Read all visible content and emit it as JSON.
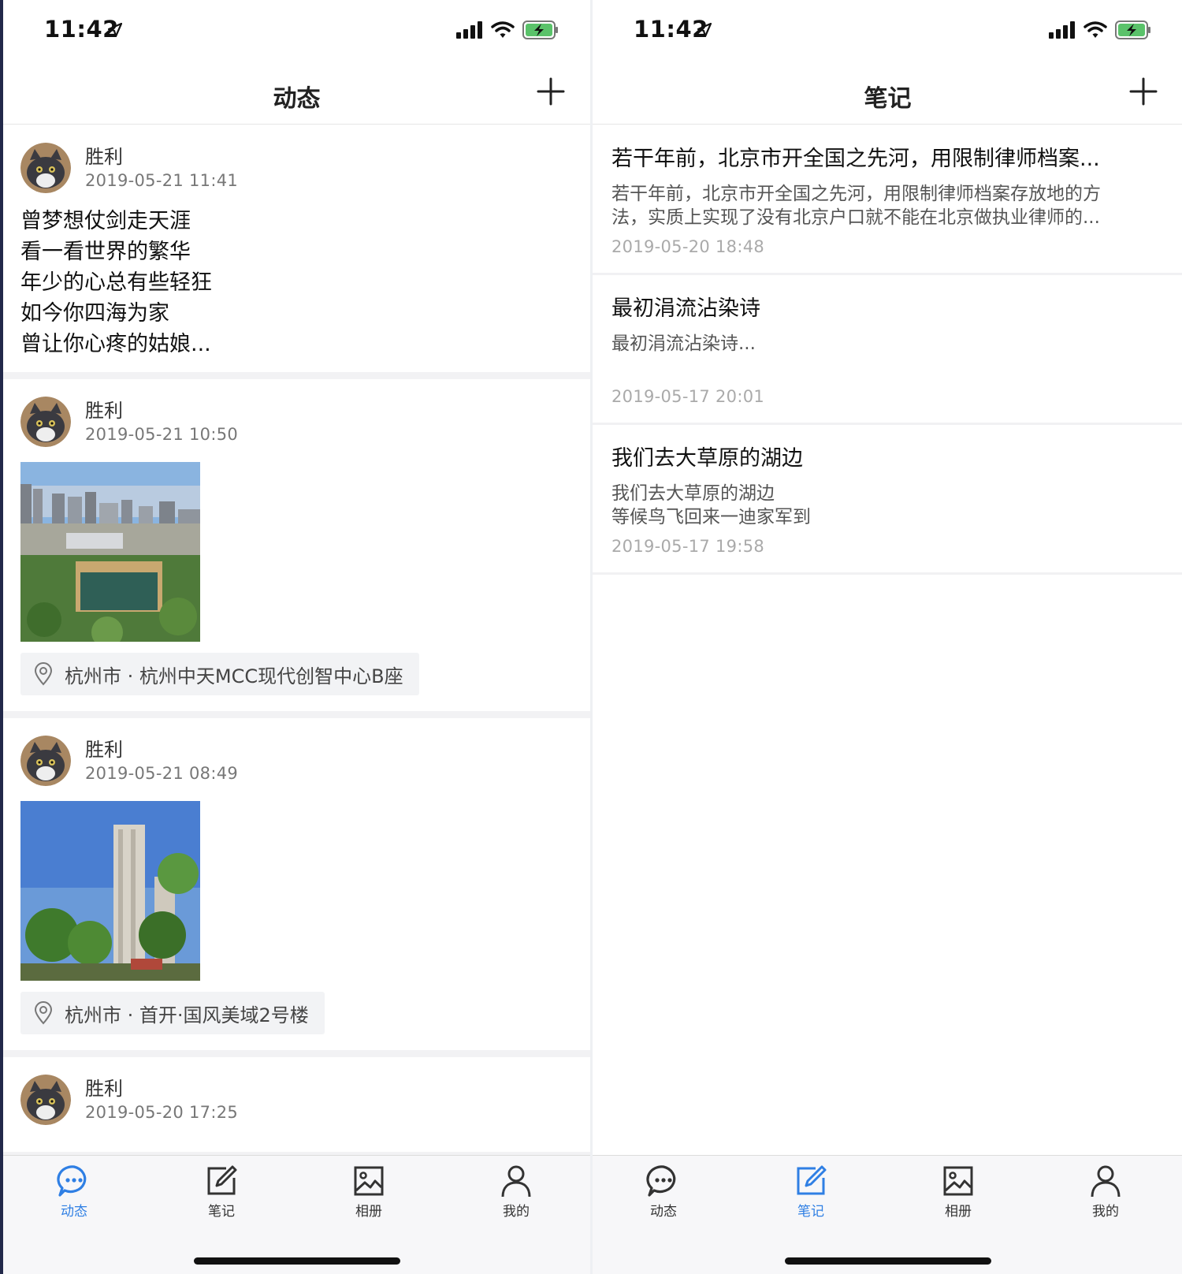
{
  "colors": {
    "accent": "#2f7fe4",
    "tab_inactive": "#333333",
    "battery_green": "#5ac26a"
  },
  "left": {
    "status": {
      "time": "11:42"
    },
    "nav": {
      "title": "动态",
      "add_icon": "plus-icon"
    },
    "posts": [
      {
        "author": "胜利",
        "time": "2019-05-21 11:41",
        "lines": [
          "曾梦想仗剑走天涯",
          "看一看世界的繁华",
          "年少的心总有些轻狂",
          "如今你四海为家",
          "曾让你心疼的姑娘..."
        ]
      },
      {
        "author": "胜利",
        "time": "2019-05-21 10:50",
        "photo": "city-aerial-photo",
        "location": "杭州市 · 杭州中天MCC现代创智中心B座"
      },
      {
        "author": "胜利",
        "time": "2019-05-21 08:49",
        "photo": "tower-photo",
        "location": "杭州市 · 首开·国风美域2号楼"
      },
      {
        "author": "胜利",
        "time": "2019-05-20 17:25"
      }
    ],
    "tabs": [
      {
        "label": "动态",
        "icon": "chat-bubble-icon",
        "active": true
      },
      {
        "label": "笔记",
        "icon": "edit-icon",
        "active": false
      },
      {
        "label": "相册",
        "icon": "image-icon",
        "active": false
      },
      {
        "label": "我的",
        "icon": "user-icon",
        "active": false
      }
    ]
  },
  "right": {
    "status": {
      "time": "11:42"
    },
    "nav": {
      "title": "笔记",
      "add_icon": "plus-icon"
    },
    "notes": [
      {
        "title": "若干年前，北京市开全国之先河，用限制律师档案...",
        "excerpt": [
          "若干年前，北京市开全国之先河，用限制律师档案存放地的方",
          "法，实质上实现了没有北京户口就不能在北京做执业律师的..."
        ],
        "time": "2019-05-20 18:48"
      },
      {
        "title": "最初涓流沾染诗",
        "excerpt": [
          "最初涓流沾染诗..."
        ],
        "time": "2019-05-17 20:01"
      },
      {
        "title": "我们去大草原的湖边",
        "excerpt": [
          "我们去大草原的湖边",
          "等候鸟飞回来一迪家军到"
        ],
        "time": "2019-05-17 19:58"
      }
    ],
    "tabs": [
      {
        "label": "动态",
        "icon": "chat-bubble-icon",
        "active": false
      },
      {
        "label": "笔记",
        "icon": "edit-icon",
        "active": true
      },
      {
        "label": "相册",
        "icon": "image-icon",
        "active": false
      },
      {
        "label": "我的",
        "icon": "user-icon",
        "active": false
      }
    ]
  }
}
